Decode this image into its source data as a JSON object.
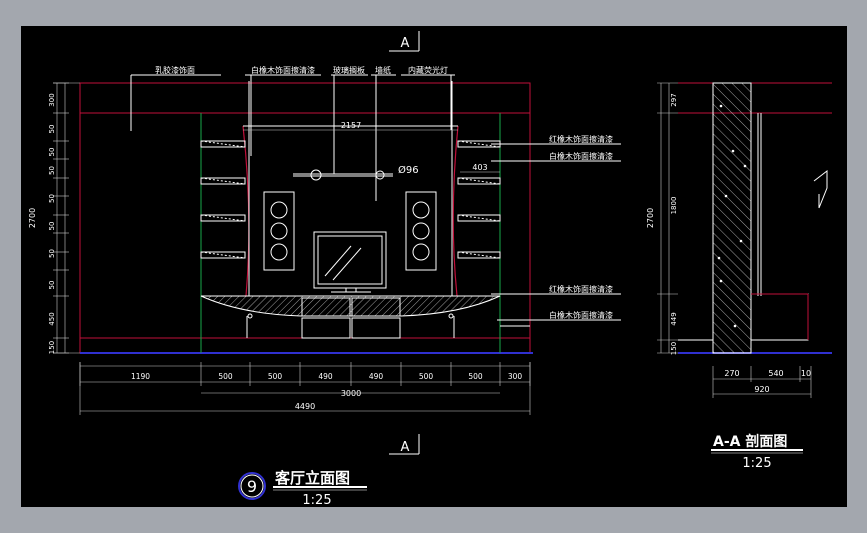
{
  "colors": {
    "background": "#000000",
    "frame": "#a3a7ae",
    "wall": "#c0103a",
    "line": "#ffffff",
    "accent_green": "#19a84a",
    "ground": "#3030d0",
    "dim": "#cccccc"
  },
  "section_marks": {
    "top": "A",
    "bottom": "A"
  },
  "callouts_top": [
    "乳胶漆饰面",
    "白橡木饰面擦清漆",
    "玻璃搁板",
    "墙纸",
    "内藏荧光灯"
  ],
  "callouts_right": [
    "红橡木饰面擦清漆",
    "白橡木饰面擦清漆",
    "红橡木饰面擦清漆",
    "白橡木饰面擦清漆"
  ],
  "elevation": {
    "dim_inner_top": "2157",
    "dim_403": "403",
    "dim_lamp": "Ø96",
    "height_total": "2700",
    "vertical_dims": [
      "300",
      "50",
      "50",
      "50",
      "50",
      "50",
      "50",
      "50",
      "450",
      "150"
    ],
    "bottom_dims": [
      "1190",
      "500",
      "500",
      "490",
      "490",
      "500",
      "500",
      "300"
    ],
    "dim_3000": "3000",
    "dim_4490": "4490",
    "title_number": "9",
    "title": "客厅立面图",
    "scale": "1:25"
  },
  "section": {
    "height_total": "2700",
    "vertical_dims": [
      "297",
      "1800",
      "449",
      "150"
    ],
    "bottom_dims": [
      "270",
      "540",
      "10"
    ],
    "dim_920": "920",
    "title": "A-A 剖面图",
    "scale": "1:25"
  }
}
